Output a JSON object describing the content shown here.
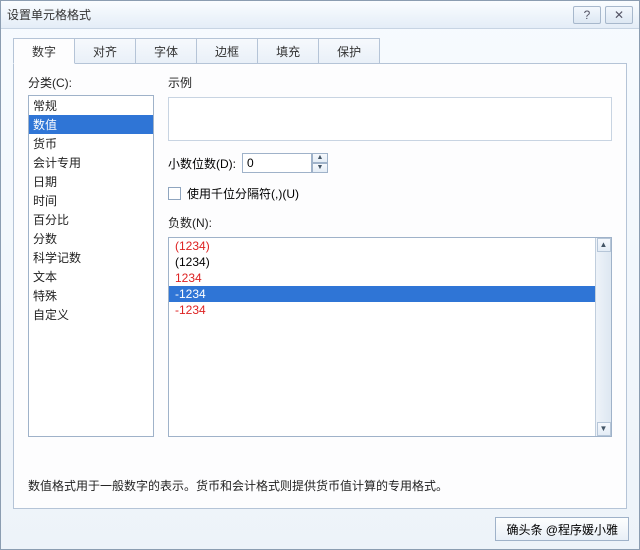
{
  "window": {
    "title": "设置单元格格式"
  },
  "tabs": [
    "数字",
    "对齐",
    "字体",
    "边框",
    "填充",
    "保护"
  ],
  "activeTab": 0,
  "category": {
    "label": "分类(C):",
    "items": [
      "常规",
      "数值",
      "货币",
      "会计专用",
      "日期",
      "时间",
      "百分比",
      "分数",
      "科学记数",
      "文本",
      "特殊",
      "自定义"
    ],
    "selectedIndex": 1
  },
  "example": {
    "label": "示例"
  },
  "decimals": {
    "label": "小数位数(D):",
    "value": "0"
  },
  "thousands": {
    "label": "使用千位分隔符(,)(U)",
    "checked": false
  },
  "negatives": {
    "label": "负数(N):",
    "items": [
      {
        "text": "(1234)",
        "color": "red"
      },
      {
        "text": "(1234)",
        "color": "black"
      },
      {
        "text": "1234",
        "color": "red"
      },
      {
        "text": "-1234",
        "color": "black"
      },
      {
        "text": "-1234",
        "color": "red"
      }
    ],
    "selectedIndex": 3
  },
  "description": "数值格式用于一般数字的表示。货币和会计格式则提供货币值计算的专用格式。",
  "footer": {
    "ok": "确头条 @程序媛小雅"
  }
}
